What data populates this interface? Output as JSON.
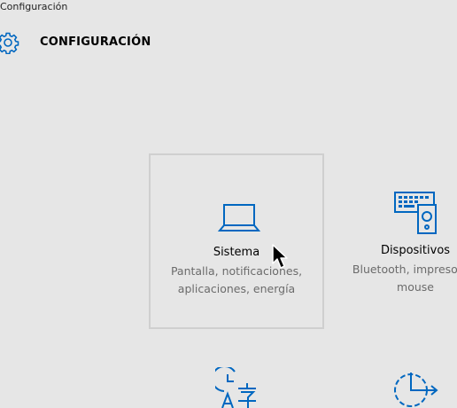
{
  "window": {
    "title": "Configuración"
  },
  "header": {
    "icon": "gear-icon",
    "title": "CONFIGURACIÓN"
  },
  "tiles": [
    {
      "icon": "laptop-icon",
      "name": "Sistema",
      "desc_line1": "Pantalla, notificaciones,",
      "desc_line2": "aplicaciones, energía"
    },
    {
      "icon": "devices-icon",
      "name": "Dispositivos",
      "desc_line1": "Bluetooth, impresoras,",
      "desc_line2": "mouse"
    }
  ],
  "bottom_icons": [
    "time-language-icon",
    "update-recovery-icon"
  ],
  "colors": {
    "accent": "#0067c0",
    "background": "#e6e6e6",
    "tile_border": "#cfcfcf",
    "desc_text": "#6b6b6b"
  }
}
